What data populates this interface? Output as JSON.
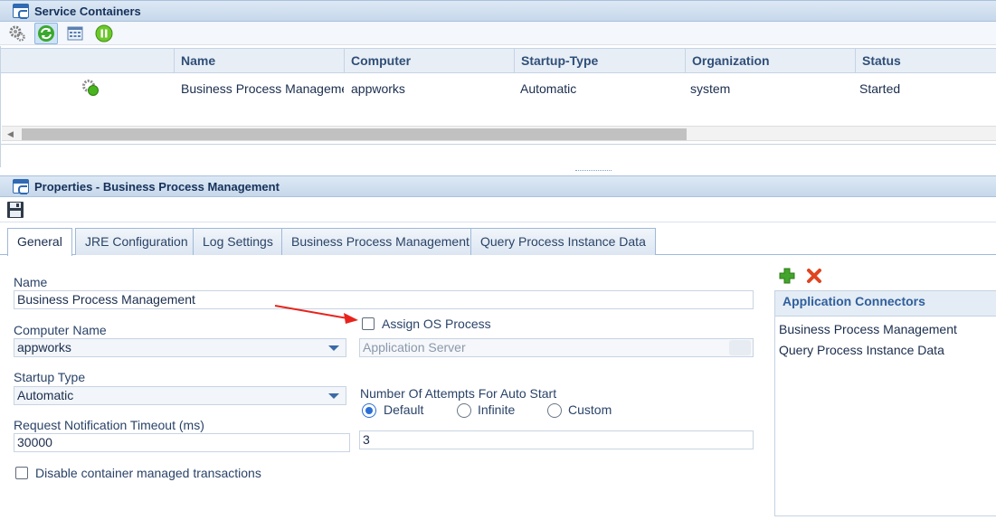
{
  "service_containers": {
    "title": "Service Containers",
    "toolbar_icons": [
      "gears-icon",
      "refresh-icon",
      "grid-icon",
      "pause-icon"
    ],
    "columns": [
      "Name",
      "Computer",
      "Startup-Type",
      "Organization",
      "Status"
    ],
    "rows": [
      {
        "name": "Business Process Manageme",
        "computer": "appworks",
        "startup_type": "Automatic",
        "organization": "system",
        "status": "Started"
      }
    ]
  },
  "properties": {
    "title": "Properties - Business Process Management",
    "tabs": [
      "General",
      "JRE Configuration",
      "Log Settings",
      "Business Process Management",
      "Query Process Instance Data"
    ],
    "active_tab": "General",
    "form": {
      "name_label": "Name",
      "name_value": "Business Process Management",
      "computer_name_label": "Computer Name",
      "computer_name_value": "appworks",
      "assign_os_label": "Assign OS Process",
      "os_process_value": "Application Server",
      "startup_type_label": "Startup Type",
      "startup_type_value": "Automatic",
      "attempts_label": "Number Of Attempts For Auto Start",
      "radio_default": "Default",
      "radio_infinite": "Infinite",
      "radio_custom": "Custom",
      "attempts_value": "3",
      "timeout_label": "Request Notification Timeout (ms)",
      "timeout_value": "30000",
      "disable_tx_label": "Disable container managed transactions"
    },
    "app_connectors": {
      "title": "Application Connectors",
      "items": [
        "Business Process Management",
        "Query Process Instance Data"
      ]
    }
  },
  "colors": {
    "accent": "#2b6fd6",
    "header_text": "#15315a",
    "annotation_arrow": "#e8231c"
  }
}
